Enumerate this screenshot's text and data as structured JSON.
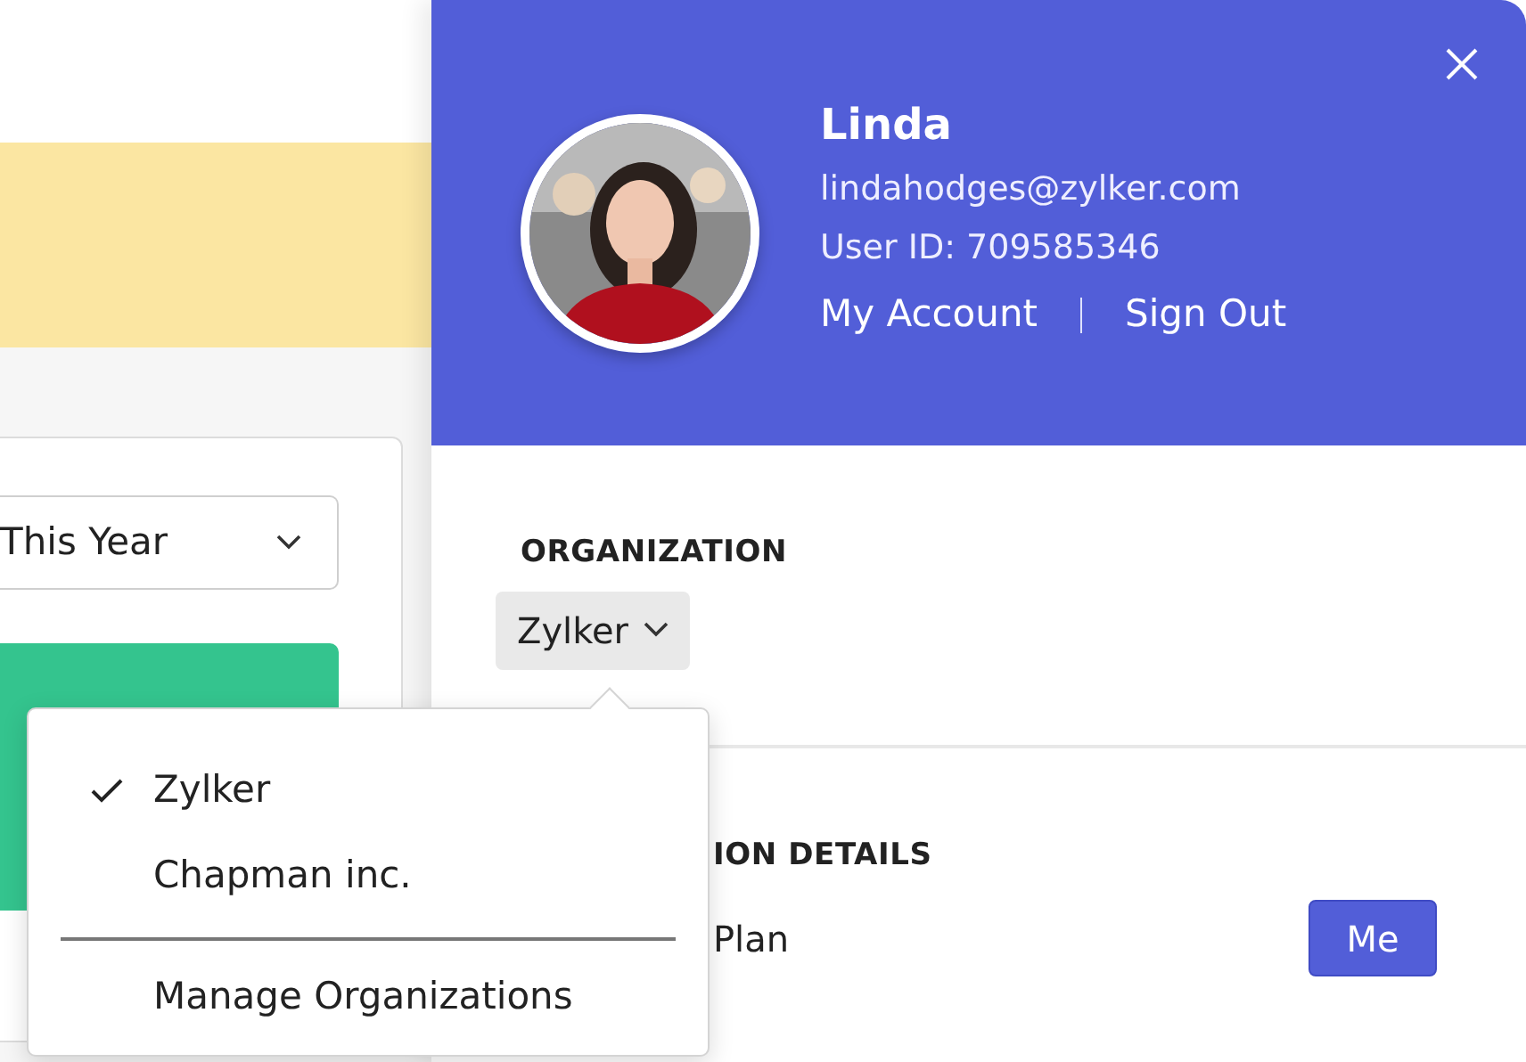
{
  "background": {
    "period_select": {
      "value": "This Year"
    }
  },
  "profile": {
    "name": "Linda",
    "email": "lindahodges@zylker.com",
    "user_id": "User ID: 709585346",
    "links": [
      {
        "label": "My Account"
      },
      {
        "label": "Sign Out"
      }
    ]
  },
  "organization": {
    "heading": "ORGANIZATION",
    "current": "Zylker"
  },
  "organization_menu": {
    "items": [
      {
        "label": "Zylker",
        "selected": true
      },
      {
        "label": "Chapman inc.",
        "selected": false
      }
    ],
    "manage": "Manage Organizations"
  },
  "details": {
    "heading": "ION DETAILS",
    "plan_label": "Plan",
    "plan_button": "Me"
  }
}
